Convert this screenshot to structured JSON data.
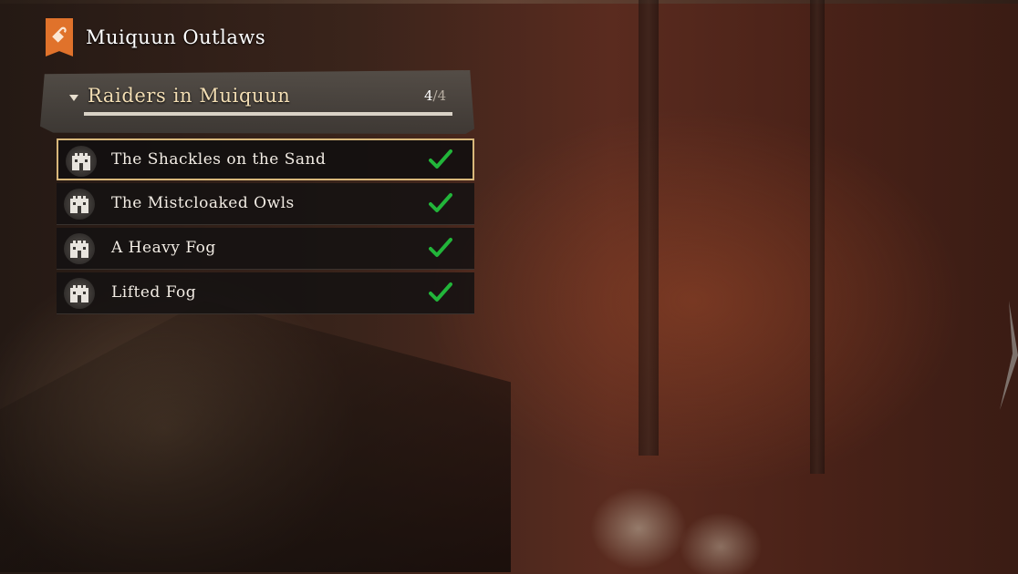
{
  "quest": {
    "title": "Muiquun Outlaws",
    "icon": "orange-banner-icon",
    "icon_color": "#e0722b"
  },
  "group": {
    "title": "Raiders in Muiquun",
    "completed": "4",
    "total": "/4",
    "progress_fraction": 1.0
  },
  "objectives": [
    {
      "label": "The Shackles on the Sand",
      "icon": "fort-icon",
      "status": "completed",
      "selected": true
    },
    {
      "label": "The Mistcloaked Owls",
      "icon": "fort-icon",
      "status": "completed",
      "selected": false
    },
    {
      "label": "A Heavy Fog",
      "icon": "fort-icon",
      "status": "completed",
      "selected": false
    },
    {
      "label": "Lifted Fog",
      "icon": "fort-icon",
      "status": "completed",
      "selected": false
    }
  ],
  "colors": {
    "check": "#22b53a",
    "selected_border": "#d8b77a",
    "group_title": "#f3deb4"
  }
}
